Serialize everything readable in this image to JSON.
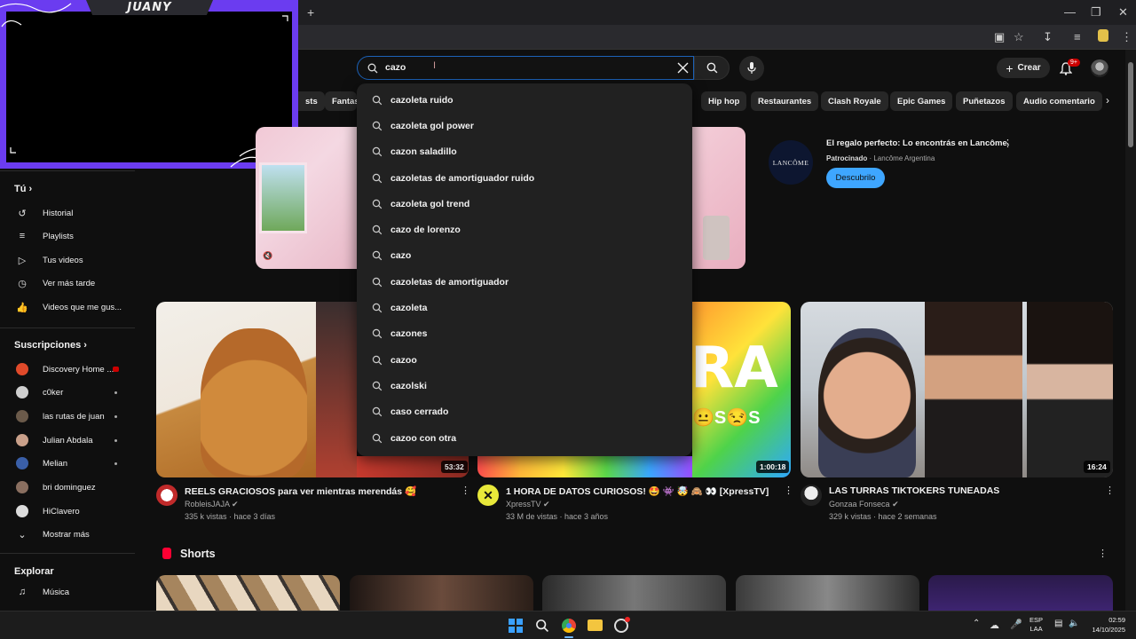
{
  "browser": {
    "new_tab_icon": "plus-icon",
    "window_controls": [
      "minimize-icon",
      "restore-icon",
      "close-icon"
    ]
  },
  "overlay": {
    "streamer_name": "JUANY"
  },
  "search": {
    "value": "cazo",
    "clear_icon": "close-icon",
    "search_icon": "search-icon",
    "mic_icon": "mic-icon"
  },
  "header": {
    "create_label": "Crear",
    "notification_badge": "9+"
  },
  "chips": [
    "sts",
    "Fantas",
    "Hip hop",
    "Restaurantes",
    "Clash Royale",
    "Epic Games",
    "Puñetazos",
    "Audio comentario"
  ],
  "suggestions": [
    "cazoleta ruido",
    "cazoleta gol power",
    "cazon saladillo",
    "cazoletas de amortiguador ruido",
    "cazoleta gol trend",
    "cazo de lorenzo",
    "cazo",
    "cazoletas de amortiguador",
    "cazoleta",
    "cazones",
    "cazoo",
    "cazolski",
    "caso cerrado",
    "cazoo con otra"
  ],
  "sidebar": {
    "you_label": "Tú",
    "you_items": [
      {
        "label": "Historial",
        "icon": "history-icon"
      },
      {
        "label": "Playlists",
        "icon": "playlists-icon"
      },
      {
        "label": "Tus videos",
        "icon": "your-videos-icon"
      },
      {
        "label": "Ver más tarde",
        "icon": "watch-later-icon"
      },
      {
        "label": "Videos que me gus...",
        "icon": "liked-icon"
      }
    ],
    "subs_label": "Suscripciones",
    "subs": [
      {
        "label": "Discovery Home ...",
        "color": "#e04a2a"
      },
      {
        "label": "c0ker",
        "color": "#cfcfcf"
      },
      {
        "label": "las rutas de juan",
        "color": "#6b5a4a"
      },
      {
        "label": "Julian Abdala",
        "color": "#c9a08a"
      },
      {
        "label": "Melian",
        "color": "#3a5fa8"
      },
      {
        "label": "bri dominguez",
        "color": "#8a6f60"
      },
      {
        "label": "HiClavero",
        "color": "#dcdcdc"
      }
    ],
    "show_more": "Mostrar más",
    "explore_label": "Explorar",
    "explore_items": [
      {
        "label": "Música",
        "icon": "music-icon"
      }
    ]
  },
  "ad": {
    "title": "El regalo perfecto: Lo encontrás en Lancôme.",
    "sponsored": "Patrocinado",
    "advertiser": "Lancôme Argentina",
    "cta": "Descubrilo",
    "logo_text": "LANCÔME"
  },
  "videos": [
    {
      "title": "REELS GRACIOSOS para ver mientras merendás 🥰",
      "channel": "RobleisJAJA",
      "meta": "335 k vistas · hace 3 días",
      "duration": "53:32"
    },
    {
      "title": "1 HORA DE DATOS CURIOSOS! 🤩 👾 🤯 🙈 👀 [XpressTV]",
      "channel": "XpressTV",
      "meta": "33 M de vistas · hace 3 años",
      "duration": "1:00:18"
    },
    {
      "title": "LAS TURRAS TIKTOKERS TUNEADAS",
      "channel": "Gonzaa Fonseca",
      "meta": "329 k vistas · hace 2 semanas",
      "duration": "16:24"
    }
  ],
  "thumb2_text": "RA",
  "shorts_label": "Shorts",
  "taskbar": {
    "lang": "ESP",
    "lang2": "LAA",
    "time": "02:59",
    "date": "14/10/2025"
  }
}
